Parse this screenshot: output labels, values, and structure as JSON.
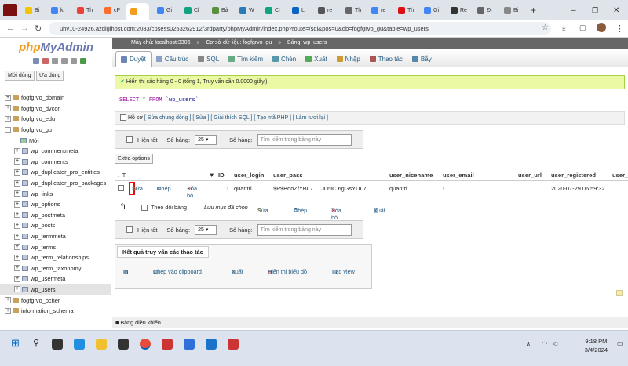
{
  "browser": {
    "tabs": [
      "Bi",
      "ki",
      "Th",
      "cP",
      "",
      "Gi",
      "Cl",
      "Bả",
      "W",
      "Cl",
      "Li",
      "re",
      "Th",
      "re",
      "Th",
      "Gi",
      "Re",
      "Đi",
      "Bi"
    ],
    "url": "uhv10-24926.azdigihost.com:2083/cpsess0253262912/3rdparty/phpMyAdmin/index.php?route=/sql&pos=0&db=fogfgrvo_gu&table=wp_users"
  },
  "sidebar": {
    "logo_a": "php",
    "logo_b": "MyAdmin",
    "recent_label": "Mới dùng",
    "favorite_label": "Ưa dùng",
    "dbs_top": [
      "fogfgrvo_dbmain",
      "fogfgrvo_dvcon",
      "fogfgrvo_edu",
      "fogfgrvo_gu"
    ],
    "new_label": "Mới",
    "tables": [
      "wp_commentmeta",
      "wp_comments",
      "wp_duplicator_pro_entities",
      "wp_duplicator_pro_packages",
      "wp_links",
      "wp_options",
      "wp_postmeta",
      "wp_posts",
      "wp_termmeta",
      "wp_terms",
      "wp_term_relationships",
      "wp_term_taxonomy",
      "wp_usermeta",
      "wp_users"
    ],
    "dbs_bottom": [
      "fogfgrvo_ocher",
      "information_schema"
    ]
  },
  "breadcrumb": {
    "server": "Máy chủ: localhost:3306",
    "db": "Cơ sở dữ liệu: fogfgrvo_gu",
    "table": "Bảng: wp_users"
  },
  "menu_tabs": [
    "Duyệt",
    "Cấu trúc",
    "SQL",
    "Tìm kiếm",
    "Chèn",
    "Xuất",
    "Nhập",
    "Thao tác",
    "Bẫy"
  ],
  "success_msg": "Hiển thị các hàng 0 - 0 (tổng 1, Truy vấn cần 0.0000 giây.)",
  "sql": {
    "kw": "SELECT",
    "star": "*",
    "from": "FROM",
    "table": "`wp_users`"
  },
  "profiling": {
    "label": "Hồ sơ",
    "links": "[ Sửa chung dòng ] [ Sửa ] [ Giải thích SQL ] [ Tạo mã PHP ] [ Làm tươi lại ]"
  },
  "navbar": {
    "show_all": "Hiện tất",
    "rows_label": "Số hàng:",
    "rows_value": "25",
    "filter_label": "Số hàng:",
    "filter_placeholder": "Tìm kiếm trong bảng này"
  },
  "extra_options": "Extra options",
  "columns": [
    "ID",
    "user_login",
    "user_pass",
    "user_nicename",
    "user_email",
    "user_url",
    "user_registered",
    "user_a"
  ],
  "row": {
    "edit": "Sửa",
    "copy": "Chép",
    "delete": "Xóa bỏ",
    "id": "1",
    "login": "quantri",
    "pass": "$P$BqoZfYBL7 ... J06IC 6gGsYUL7",
    "nicename": "quantri",
    "email": "t...",
    "registered": "2020-07-29 06:59:32"
  },
  "bulk": {
    "check_all": "Theo dõi bảng",
    "with_selected": "Lưu mục đã chọn",
    "edit": "Sửa",
    "copy": "Chép",
    "delete": "Xóa bỏ",
    "export": "Xuất"
  },
  "query_ops": {
    "title": "Kết quả truy vấn các thao tác",
    "items": [
      "In",
      "Chép vào clipboard",
      "Xuất",
      "Hiển thị biểu đồ",
      "Tạo view"
    ]
  },
  "console": "Bảng điều khiển",
  "taskbar": {
    "time": "9:18 PM",
    "date": "3/4/2024"
  }
}
